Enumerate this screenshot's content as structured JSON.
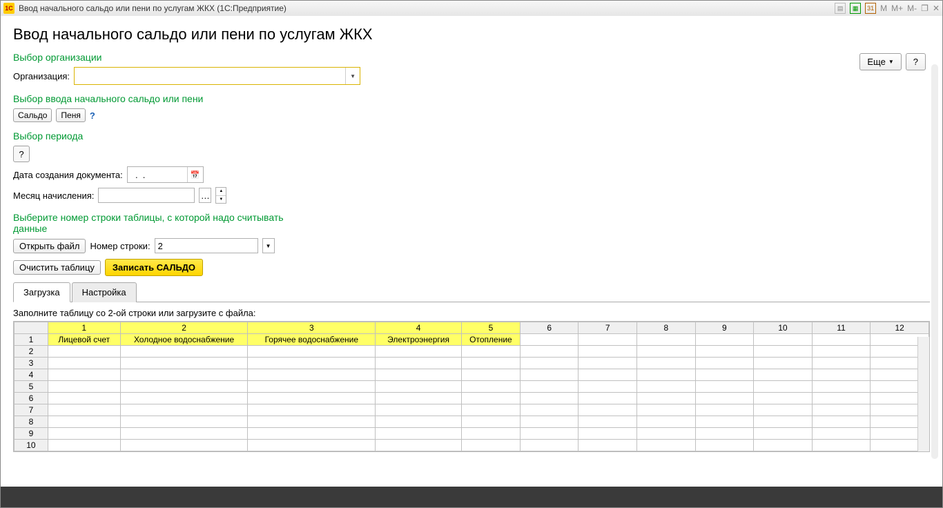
{
  "window": {
    "app_logo_text": "1C",
    "title": "Ввод начального сальдо или пени по услугам ЖКХ  (1С:Предприятие)",
    "m_labels": [
      "M",
      "M+",
      "M-"
    ]
  },
  "page": {
    "title": "Ввод начального сальдо или пени по услугам ЖКХ",
    "more_button": "Еще",
    "help_button": "?"
  },
  "org": {
    "section": "Выбор организации",
    "label": "Организация:",
    "value": ""
  },
  "mode": {
    "section": "Выбор ввода начального сальдо или пени",
    "saldo": "Сальдо",
    "penya": "Пеня"
  },
  "period": {
    "section": "Выбор периода",
    "doc_date_label": "Дата создания документа:",
    "doc_date_value": "  .  .    ",
    "month_label": "Месяц начисления:",
    "month_value": ""
  },
  "rowselect": {
    "section": "Выберите номер строки таблицы, с которой надо считывать данные",
    "open_file": "Открыть файл",
    "row_label": "Номер строки:",
    "row_value": "2"
  },
  "actions": {
    "clear_table": "Очистить таблицу",
    "write_saldo": "Записать САЛЬДО"
  },
  "tabs": {
    "load": "Загрузка",
    "settings": "Настройка"
  },
  "grid": {
    "hint": "Заполните таблицу со 2-ой строки или загрузите с файла:",
    "col_count": 12,
    "row_count": 11,
    "row1": [
      "Лицевой счет",
      "Холодное водоснабжение",
      "Горячее водоснабжение",
      "Электроэнергия",
      "Отопление"
    ]
  }
}
